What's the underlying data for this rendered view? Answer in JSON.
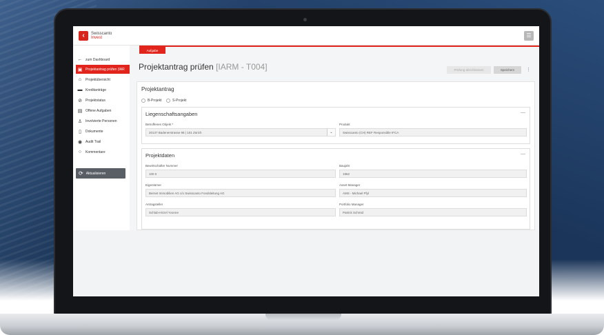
{
  "brand": {
    "name_line1": "Swisscanto",
    "name_line2": "Invest",
    "accent_color": "#e2251c"
  },
  "sidebar": {
    "items": [
      {
        "label": "zum Dashboard",
        "icon": "arrow-left-icon"
      },
      {
        "label": "Projektantrag prüfen (IAR",
        "icon": "clipboard-icon",
        "active": true
      },
      {
        "label": "Projektübersicht",
        "icon": "home-icon"
      },
      {
        "label": "Kreditanträge",
        "icon": "card-icon"
      },
      {
        "label": "Projektstatus",
        "icon": "check-circle-icon"
      },
      {
        "label": "Offene Aufgaben",
        "icon": "calendar-icon"
      },
      {
        "label": "Involvierte Personen",
        "icon": "person-icon"
      },
      {
        "label": "Dokumente",
        "icon": "document-icon"
      },
      {
        "label": "Audit Trail",
        "icon": "eye-icon"
      },
      {
        "label": "Kommentare",
        "icon": "comment-icon"
      }
    ],
    "refresh_label": "Aktualisieren"
  },
  "main": {
    "task_chip": "Aufgabe",
    "title": "Projektantrag prüfen",
    "title_ref": "[IARM - T004]",
    "check_button": "Prüfung abschliessen",
    "save_button": "Speichern",
    "card_title": "Projektantrag",
    "radio_options": [
      "B-Projekt",
      "S-Projekt"
    ],
    "sections": {
      "property": {
        "title": "Liegenschaftsangaben",
        "object_label": "Betroffenes Objekt *",
        "object_value": "20137 Badenerstrasse 98 | 101 Zürich",
        "product_label": "Produkt",
        "product_value": "Swisscanto (CH) REF Responsible IFCA"
      },
      "project": {
        "title": "Projektdaten",
        "manager_no_label": "Bewirtschafter Nummer",
        "manager_no_value": "100 0",
        "year_label": "Baujahr",
        "year_value": "1962",
        "owner_label": "Eigentümer",
        "owner_value": "Bernet Immobilien AG c/o Swisscanto Fondsleitung AG",
        "asset_label": "Asset Manager",
        "asset_value": "AMS - Michael Pfyl",
        "applicant_label": "Antragsteller",
        "applicant_value": "Schlub-Hirzel Yvonne",
        "portfolio_label": "Portfolio Manager",
        "portfolio_value": "Patrick Schmid"
      }
    }
  }
}
